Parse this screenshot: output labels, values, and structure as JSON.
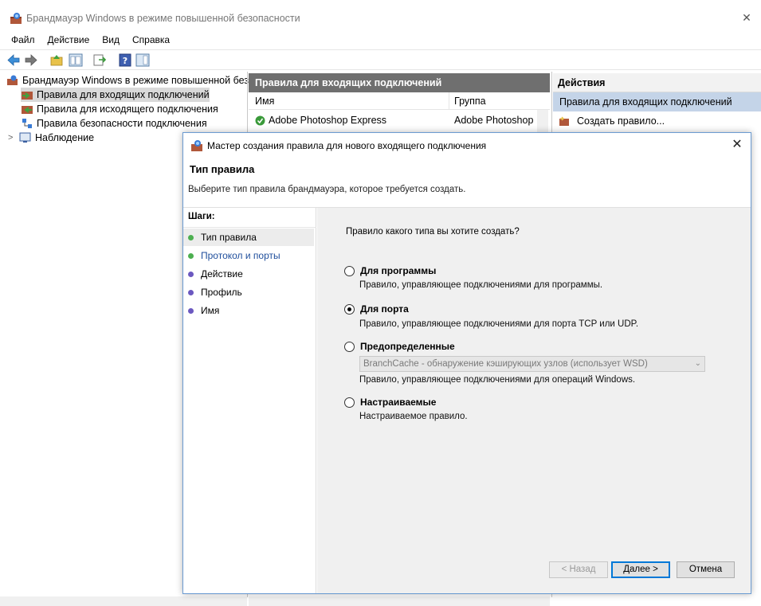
{
  "window": {
    "title": "Брандмауэр Windows в режиме повышенной безопасности",
    "close_label": "✕"
  },
  "menu": [
    "Файл",
    "Действие",
    "Вид",
    "Справка"
  ],
  "tree": {
    "root": "Брандмауэр Windows в режиме повышенной безо",
    "items": [
      "Правила для входящих подключений",
      "Правила для исходящего подключения",
      "Правила безопасности подключения",
      "Наблюдение"
    ],
    "expander": ">"
  },
  "center": {
    "header": "Правила для входящих подключений",
    "columns": [
      "Имя",
      "Группа"
    ],
    "rows": [
      {
        "name": "Adobe Photoshop Express",
        "group": "Adobe Photoshop I"
      }
    ]
  },
  "actions": {
    "header": "Действия",
    "section": "Правила для входящих подключений",
    "items": [
      "Создать правило..."
    ]
  },
  "dialog": {
    "title": "Мастер создания правила для нового входящего подключения",
    "close_label": "✕",
    "heading": "Тип правила",
    "subheading": "Выберите тип правила брандмауэра, которое требуется создать.",
    "steps_label": "Шаги:",
    "steps": [
      {
        "label": "Тип правила",
        "status": "green",
        "active": true,
        "link": false
      },
      {
        "label": "Протокол и порты",
        "status": "green",
        "active": false,
        "link": true
      },
      {
        "label": "Действие",
        "status": "purple",
        "active": false,
        "link": false
      },
      {
        "label": "Профиль",
        "status": "purple",
        "active": false,
        "link": false
      },
      {
        "label": "Имя",
        "status": "purple",
        "active": false,
        "link": false
      }
    ],
    "question": "Правило какого типа вы хотите создать?",
    "options": [
      {
        "label": "Для программы",
        "desc": "Правило, управляющее подключениями для программы.",
        "selected": false
      },
      {
        "label": "Для порта",
        "desc": "Правило, управляющее подключениями для порта TCP или UDP.",
        "selected": true
      },
      {
        "label": "Предопределенные",
        "desc": "Правило, управляющее подключениями для операций Windows.",
        "selected": false
      },
      {
        "label": "Настраиваемые",
        "desc": "Настраиваемое правило.",
        "selected": false
      }
    ],
    "predefined_combo": "BranchCache - обнаружение кэширующих узлов (использует WSD)",
    "buttons": {
      "back": "< Назад",
      "next": "Далее >",
      "cancel": "Отмена"
    }
  },
  "colors": {
    "center_header_bg": "#6f6f6f",
    "actions_selected_bg": "#c4d4e8",
    "primary_button_border": "#0078d7",
    "step_done": "#4caf50",
    "step_pending": "#6b58c0"
  }
}
